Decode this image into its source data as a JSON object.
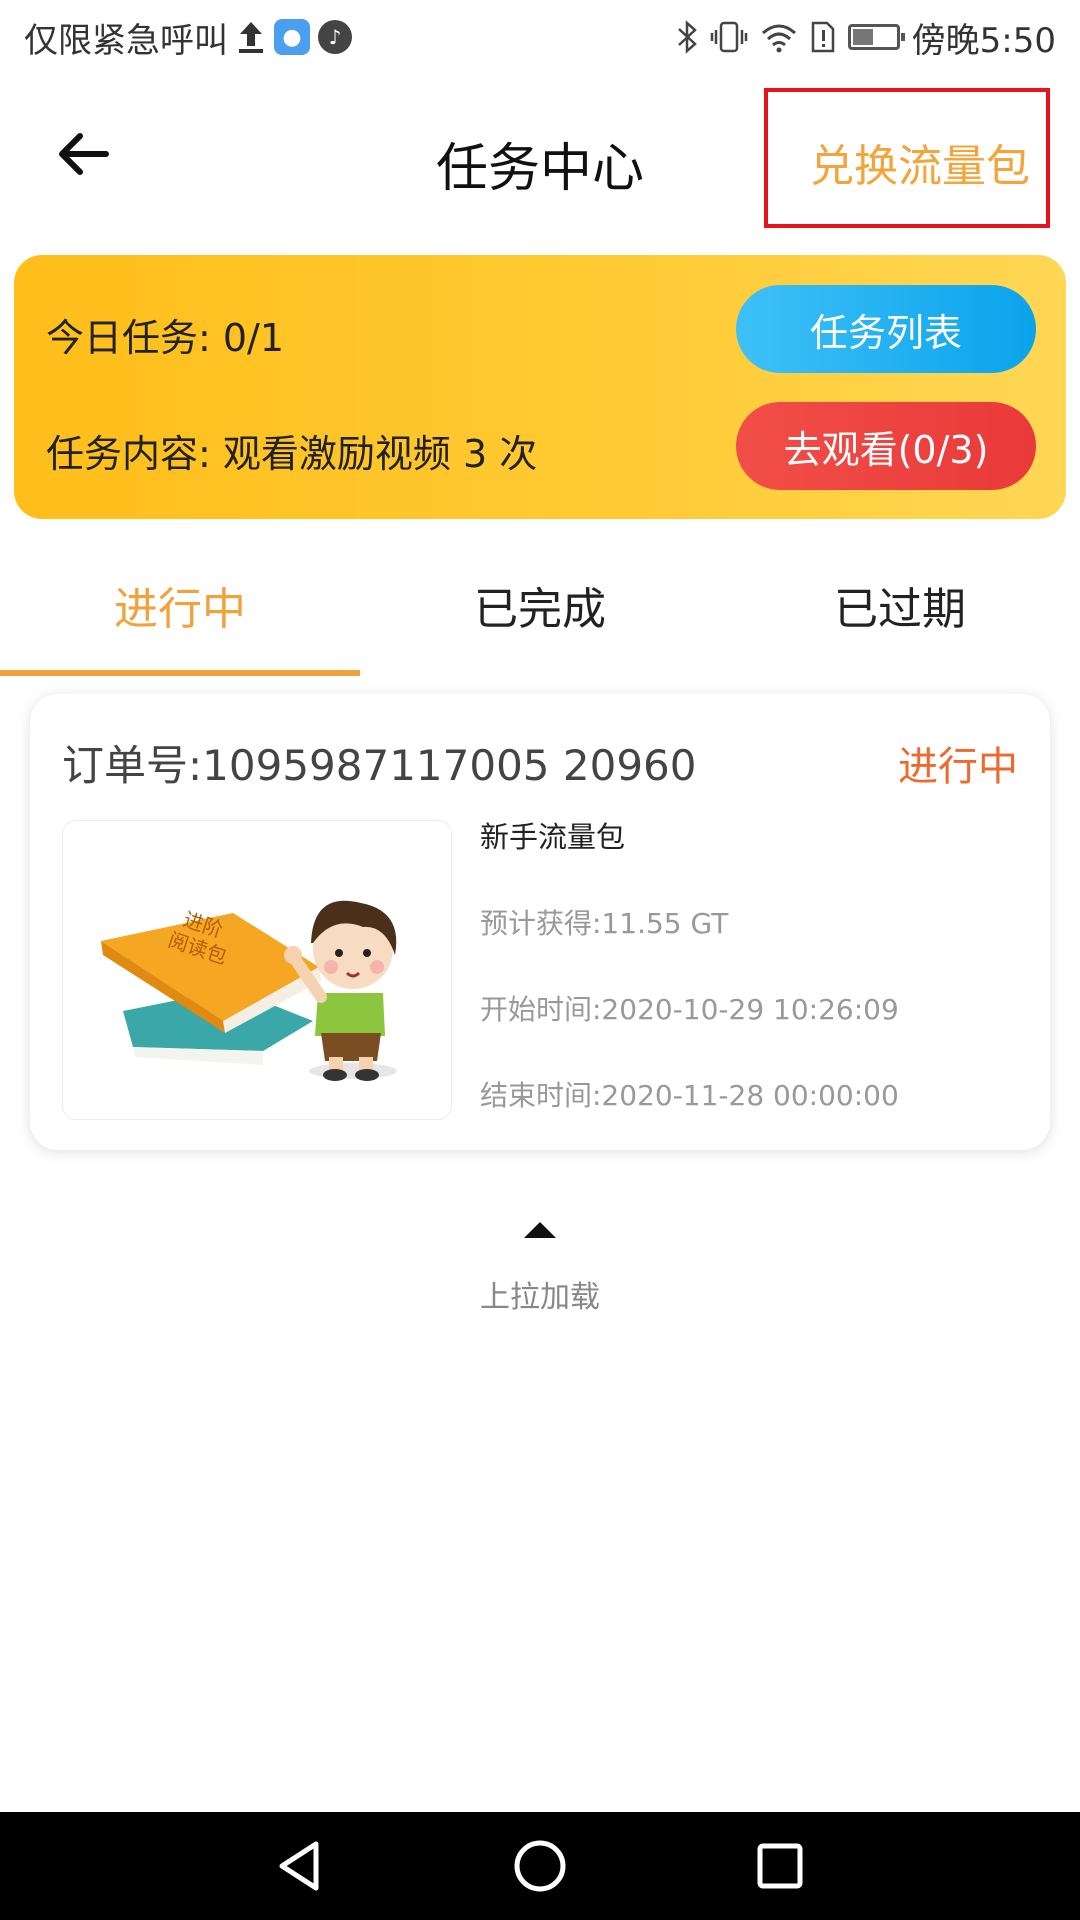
{
  "status_bar": {
    "carrier": "仅限紧急呼叫",
    "time": "傍晚5:50",
    "icons": [
      "upload-icon",
      "app-icon",
      "tiktok-icon",
      "bluetooth-icon",
      "vibrate-icon",
      "wifi-icon",
      "sim-alert-icon",
      "battery-icon"
    ]
  },
  "header": {
    "title": "任务中心",
    "exchange_label": "兑换流量包"
  },
  "banner": {
    "today_task": "今日任务: 0/1",
    "task_content": "任务内容: 观看激励视频 3 次",
    "task_list_button": "任务列表",
    "watch_button": "去观看(0/3)"
  },
  "tabs": [
    {
      "label": "进行中",
      "active": true
    },
    {
      "label": "已完成",
      "active": false
    },
    {
      "label": "已过期",
      "active": false
    }
  ],
  "order": {
    "order_no": "订单号:1095987117005 20960",
    "status": "进行中",
    "package_name": "新手流量包",
    "expected": "预计获得:11.55 GT",
    "start_time": "开始时间:2020-10-29 10:26:09",
    "end_time": "结束时间:2020-11-28 00:00:00",
    "book_text": "进阶\n阅读包"
  },
  "load_more": "上拉加载",
  "colors": {
    "accent_orange": "#f2a23a",
    "status_orange": "#ec6a2c",
    "banner_yellow": "#ffc21f",
    "button_blue": "#13a8ee",
    "button_red": "#ee4440",
    "highlight_red": "#e8141c"
  }
}
